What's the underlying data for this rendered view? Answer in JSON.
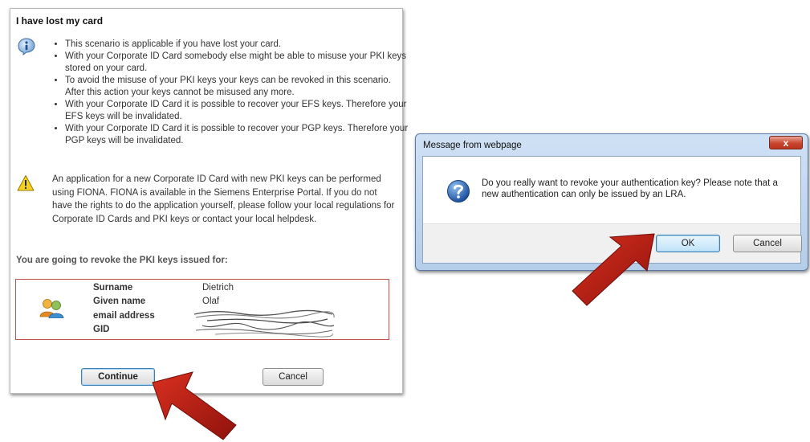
{
  "left_panel": {
    "title": "I have lost my card",
    "bullets": [
      "This scenario is applicable if you have lost your card.",
      "With your Corporate ID Card somebody else might be able to misuse your PKI keys stored on your card.",
      "To avoid the misuse of your PKI keys your keys can be revoked in this scenario. After this action your keys cannot be misused any more.",
      "With your Corporate ID Card it is possible to recover your EFS keys. Therefore your EFS keys will be invalidated.",
      "With your Corporate ID Card it is possible to recover your PGP keys. Therefore your PGP keys will be invalidated."
    ],
    "warning_text": "An application for a new Corporate ID Card with new PKI keys can be performed using FIONA. FIONA is available in the Siemens Enterprise Portal. If you do not have the rights to do the application yourself, please follow your local regulations for Corporate ID Cards and PKI keys or contact your local helpdesk.",
    "revoke_heading": "You are going to revoke the PKI keys issued for:",
    "user": {
      "surname_label": "Surname",
      "surname_value": "Dietrich",
      "given_name_label": "Given name",
      "given_name_value": "Olaf",
      "email_label": "email address",
      "gid_label": "GID"
    },
    "continue_label": "Continue",
    "cancel_label": "Cancel"
  },
  "dialog": {
    "title": "Message from webpage",
    "close_glyph": "x",
    "message": "Do you really want to revoke your authentication key? Please note that a new authentication can only be issued by an LRA.",
    "ok_label": "OK",
    "cancel_label": "Cancel"
  },
  "icons": {
    "info": "info-icon",
    "warning": "warning-icon",
    "users": "users-icon",
    "question": "question-icon",
    "arrows": "red-arrow-icon"
  },
  "colors": {
    "arrow": "#b01a14",
    "user_box_border": "#c0504d",
    "dialog_title_bar": "#b4cde9"
  }
}
